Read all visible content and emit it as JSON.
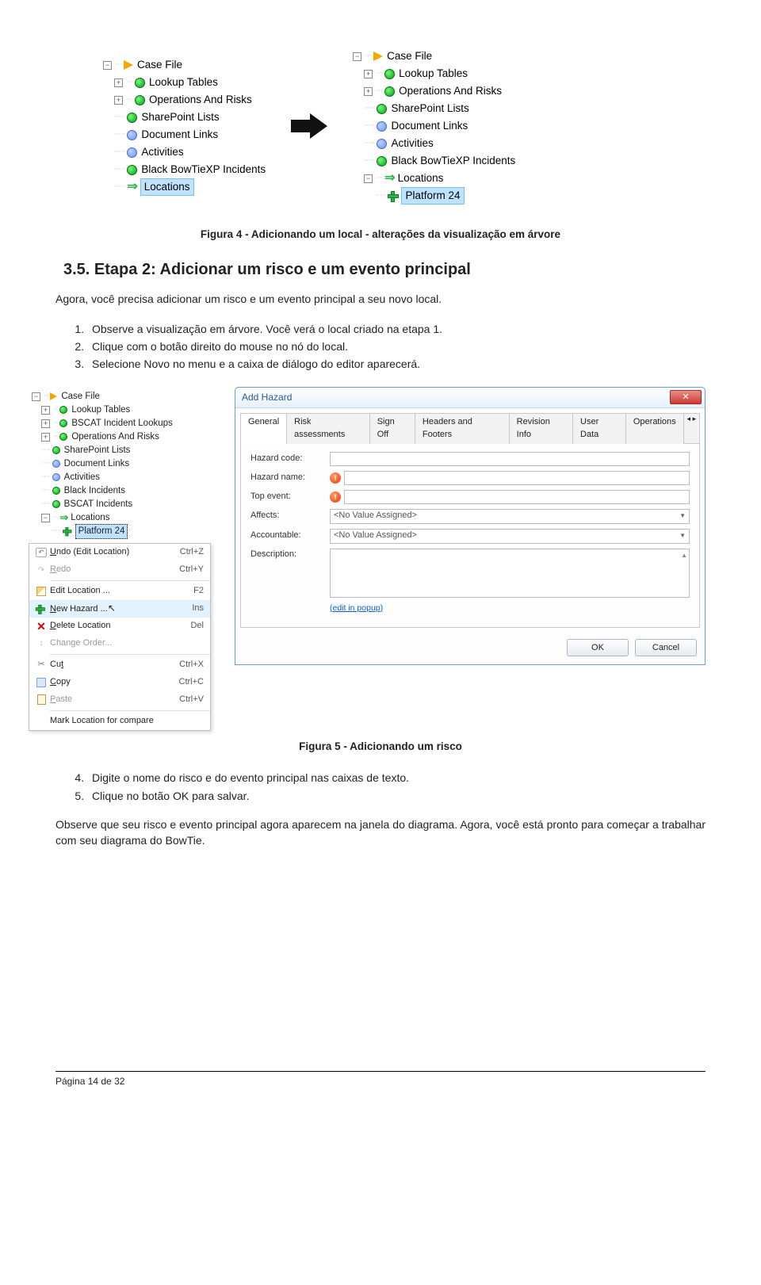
{
  "tree_left": {
    "root": "Case File",
    "items": [
      "Lookup Tables",
      "Operations And Risks",
      "SharePoint Lists",
      "Document Links",
      "Activities",
      "Black BowTieXP Incidents",
      "Locations"
    ]
  },
  "tree_right": {
    "root": "Case File",
    "items": [
      "Lookup Tables",
      "Operations And Risks",
      "SharePoint Lists",
      "Document Links",
      "Activities",
      "Black BowTieXP Incidents",
      "Locations"
    ],
    "new_child": "Platform 24"
  },
  "fig4_caption": "Figura 4 - Adicionando um local - alterações da visualização em árvore",
  "section": {
    "num": "3.5.",
    "title": "Etapa 2: Adicionar um risco e um evento principal"
  },
  "intro": "Agora, você precisa adicionar um risco e um evento principal a seu novo local.",
  "steps_a": [
    "Observe a visualização em árvore. Você verá o local criado na etapa 1.",
    "Clique com o botão direito do mouse no nó do local.",
    "Selecione Novo no menu e a caixa de diálogo do editor aparecerá."
  ],
  "tree5": {
    "root": "Case File",
    "items": [
      "Lookup Tables",
      "BSCAT Incident Lookups",
      "Operations And Risks",
      "SharePoint Lists",
      "Document Links",
      "Activities",
      "Black Incidents",
      "BSCAT Incidents",
      "Locations"
    ],
    "selected": "Platform 24"
  },
  "ctxmenu": {
    "undo": "Undo (Edit Location)",
    "undo_sc": "Ctrl+Z",
    "redo": "Redo",
    "redo_sc": "Ctrl+Y",
    "edit": "Edit Location ...",
    "edit_sc": "F2",
    "new": "New Hazard ...",
    "new_sc": "Ins",
    "del": "Delete Location",
    "del_sc": "Del",
    "order": "Change Order...",
    "cut": "Cut",
    "cut_sc": "Ctrl+X",
    "copy": "Copy",
    "copy_sc": "Ctrl+C",
    "paste": "Paste",
    "paste_sc": "Ctrl+V",
    "mark": "Mark Location for compare"
  },
  "dialog": {
    "title": "Add Hazard",
    "tabs": [
      "General",
      "Risk assessments",
      "Sign Off",
      "Headers and Footers",
      "Revision Info",
      "User Data",
      "Operations"
    ],
    "fields": {
      "code": "Hazard code:",
      "name": "Hazard name:",
      "top": "Top event:",
      "affects": "Affects:",
      "affects_val": "<No Value Assigned>",
      "account": "Accountable:",
      "account_val": "<No Value Assigned>",
      "desc": "Description:",
      "editlink": "(edit in popup)"
    },
    "ok": "OK",
    "cancel": "Cancel"
  },
  "fig5_caption": "Figura 5 - Adicionando um risco",
  "steps_b": [
    "Digite o nome do risco e do evento principal nas caixas de texto.",
    "Clique no botão OK para salvar."
  ],
  "outro": "Observe que seu risco e evento principal agora aparecem na janela do diagrama. Agora, você está pronto para começar a trabalhar com seu diagrama do BowTie.",
  "footer": "Página 14 de 32"
}
